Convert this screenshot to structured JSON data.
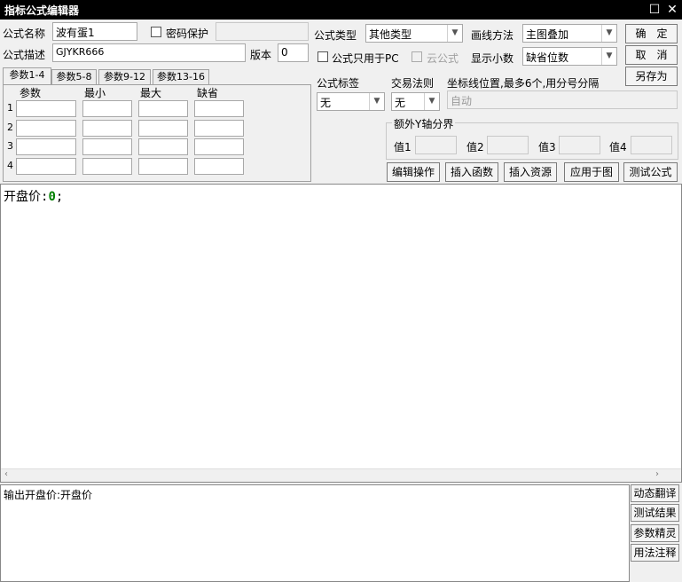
{
  "window": {
    "title": "指标公式编辑器",
    "maximize_glyph": "☐",
    "close_glyph": "✕"
  },
  "form": {
    "name_label": "公式名称",
    "name_value": "波有蛋1",
    "password_label": "密码保护",
    "password_value": "",
    "desc_label": "公式描述",
    "desc_value": "GJYKR666",
    "version_label": "版本",
    "version_value": "0",
    "type_label": "公式类型",
    "type_value": "其他类型",
    "draw_label": "画线方法",
    "draw_value": "主图叠加",
    "pc_only_label": "公式只用于PC",
    "cloud_label": "云公式",
    "decimals_label": "显示小数",
    "decimals_value": "缺省位数",
    "tag_label": "公式标签",
    "tag_value": "无",
    "rule_label": "交易法则",
    "rule_value": "无",
    "coord_label": "坐标线位置,最多6个,用分号分隔",
    "coord_value": "自动",
    "extra_y_label": "额外Y轴分界",
    "y_vals": [
      "值1",
      "值2",
      "值3",
      "值4"
    ]
  },
  "buttons": {
    "ok": "确　定",
    "cancel": "取　消",
    "save_as": "另存为",
    "edit_op": "编辑操作",
    "insert_func": "插入函数",
    "insert_res": "插入资源",
    "apply_chart": "应用于图",
    "test_formula": "测试公式"
  },
  "params": {
    "tabs": [
      "参数1-4",
      "参数5-8",
      "参数9-12",
      "参数13-16"
    ],
    "headers": [
      "参数",
      "最小",
      "最大",
      "缺省"
    ],
    "rows": [
      "1",
      "2",
      "3",
      "4"
    ]
  },
  "editor": {
    "code_name": "开盘价",
    "code_colon": ":",
    "code_value": "0",
    "code_end": ";"
  },
  "output": {
    "text": "输出开盘价:开盘价"
  },
  "side": [
    "动态翻译",
    "测试结果",
    "参数精灵",
    "用法注释"
  ],
  "colors": {
    "titlebar": "#000000",
    "code_value": "#008000"
  }
}
